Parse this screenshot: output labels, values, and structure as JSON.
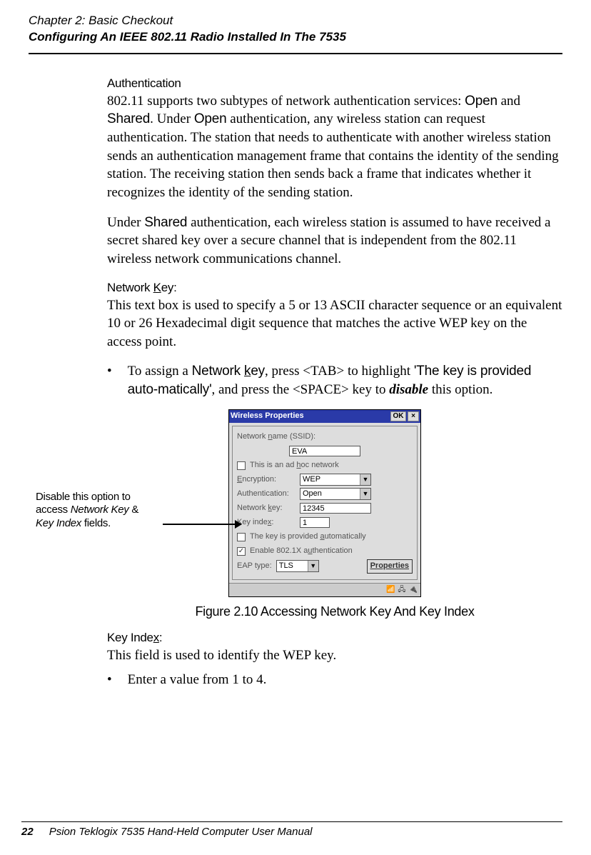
{
  "header": {
    "chapter": "Chapter 2: Basic Checkout",
    "title": "Configuring An IEEE 802.11 Radio Installed In The 7535"
  },
  "sections": {
    "auth_label": "Authentication",
    "auth_p1_a": "802.11 supports two subtypes of network authentication services: ",
    "auth_p1_open": "Open",
    "auth_p1_b": " and ",
    "auth_p1_shared": "Shared",
    "auth_p1_c": ". Under ",
    "auth_p1_open2": "Open",
    "auth_p1_d": " authentication, any wireless station can request authentication. The station that needs to authenticate with another wireless station sends an authentication management frame that contains the identity of the sending station. The receiving station then sends back a frame that indicates whether it recognizes the identity of the sending station.",
    "auth_p2_a": "Under ",
    "auth_p2_shared": "Shared",
    "auth_p2_b": " authentication, each wireless station is assumed to have received a secret shared key over a secure channel that is independent from the 802.11 wireless network communications channel.",
    "netkey_label_a": "Network ",
    "netkey_label_b": "K",
    "netkey_label_c": "ey:",
    "netkey_p": "This text box is used to specify a 5 or 13 ASCII character sequence or an equivalent 10 or 26 Hexadecimal digit sequence that matches the active WEP key on the access point.",
    "bullet_a": "To assign a ",
    "bullet_b": "Network ",
    "bullet_b2": "k",
    "bullet_b3": "ey",
    "bullet_c": ", press <TAB> to highlight ",
    "bullet_d": "'The key is provided auto-matically'",
    "bullet_e": ", and press the <SPACE> key to ",
    "bullet_f": "disable",
    "bullet_g": " this option.",
    "keyidx_label_a": "Key Inde",
    "keyidx_label_b": "x",
    "keyidx_label_c": ":",
    "keyidx_p": "This field is used to identify the WEP key.",
    "keyidx_bullet": "Enter a value from 1 to 4."
  },
  "callout": {
    "line1": "Disable this option to",
    "line2_a": "access ",
    "line2_b": "Network Key",
    "line2_c": " &",
    "line3_a": "Key Index",
    "line3_b": " fields."
  },
  "screenshot": {
    "title": "Wireless Properties",
    "ok": "OK",
    "close": "×",
    "ssid_label_a": "Network ",
    "ssid_label_b": "n",
    "ssid_label_c": "ame (SSID):",
    "ssid_value": "EVA",
    "adhoc_a": "This is an ad ",
    "adhoc_b": "h",
    "adhoc_c": "oc network",
    "enc_label_a": "E",
    "enc_label_b": "ncryption:",
    "enc_value": "WEP",
    "auth_label": "Authentication:",
    "auth_value": "Open",
    "netkey_label_a": "Network ",
    "netkey_label_b": "k",
    "netkey_label_c": "ey:",
    "netkey_value": "12345",
    "keyidx_label_a": "Key inde",
    "keyidx_label_b": "x",
    "keyidx_label_c": ":",
    "keyidx_value": "1",
    "provided_a": "The key is provided ",
    "provided_b": "a",
    "provided_c": "utomatically",
    "enable_a": "Enable 802.1X a",
    "enable_b": "u",
    "enable_c": "thentication",
    "eap_label": "EAP type:",
    "eap_value": "TLS",
    "properties_a": "P",
    "properties_b": "roperties",
    "check": "✓",
    "tray1": "📶",
    "tray2": "🖧",
    "tray3": "🔌"
  },
  "caption": "Figure 2.10 Accessing Network Key And Key Index",
  "footer": {
    "page": "22",
    "text": "Psion Teklogix 7535 Hand-Held Computer User Manual"
  }
}
